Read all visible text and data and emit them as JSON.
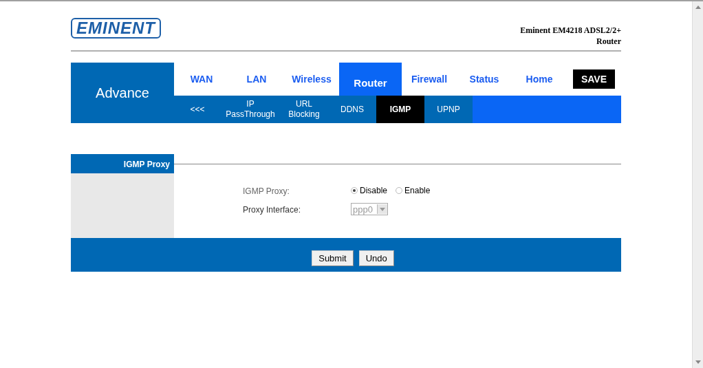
{
  "logo": "EMINENT",
  "product_title": [
    "Eminent EM4218 ADSL2/2+",
    "Router"
  ],
  "section_name": "Advance",
  "tabs": [
    {
      "label": "WAN",
      "selected": false
    },
    {
      "label": "LAN",
      "selected": false
    },
    {
      "label": "Wireless",
      "selected": false
    },
    {
      "label": "Router",
      "selected": true
    },
    {
      "label": "Firewall",
      "selected": false
    },
    {
      "label": "Status",
      "selected": false
    },
    {
      "label": "Home",
      "selected": false
    }
  ],
  "save_button": "SAVE",
  "subtabs": [
    {
      "label": "<<<",
      "selected": false
    },
    {
      "label": "IP PassThrough",
      "selected": false
    },
    {
      "label": "URL Blocking",
      "selected": false
    },
    {
      "label": "DDNS",
      "selected": false
    },
    {
      "label": "IGMP",
      "selected": true
    },
    {
      "label": "UPNP",
      "selected": false
    }
  ],
  "panel_title": "IGMP Proxy",
  "form": {
    "igmp_proxy": {
      "label": "IGMP Proxy:",
      "options": [
        {
          "label": "Disable",
          "selected": true
        },
        {
          "label": "Enable",
          "selected": false
        }
      ]
    },
    "proxy_interface": {
      "label": "Proxy Interface:",
      "value": "ppp0",
      "disabled": true
    }
  },
  "buttons": [
    "Submit",
    "Undo"
  ]
}
